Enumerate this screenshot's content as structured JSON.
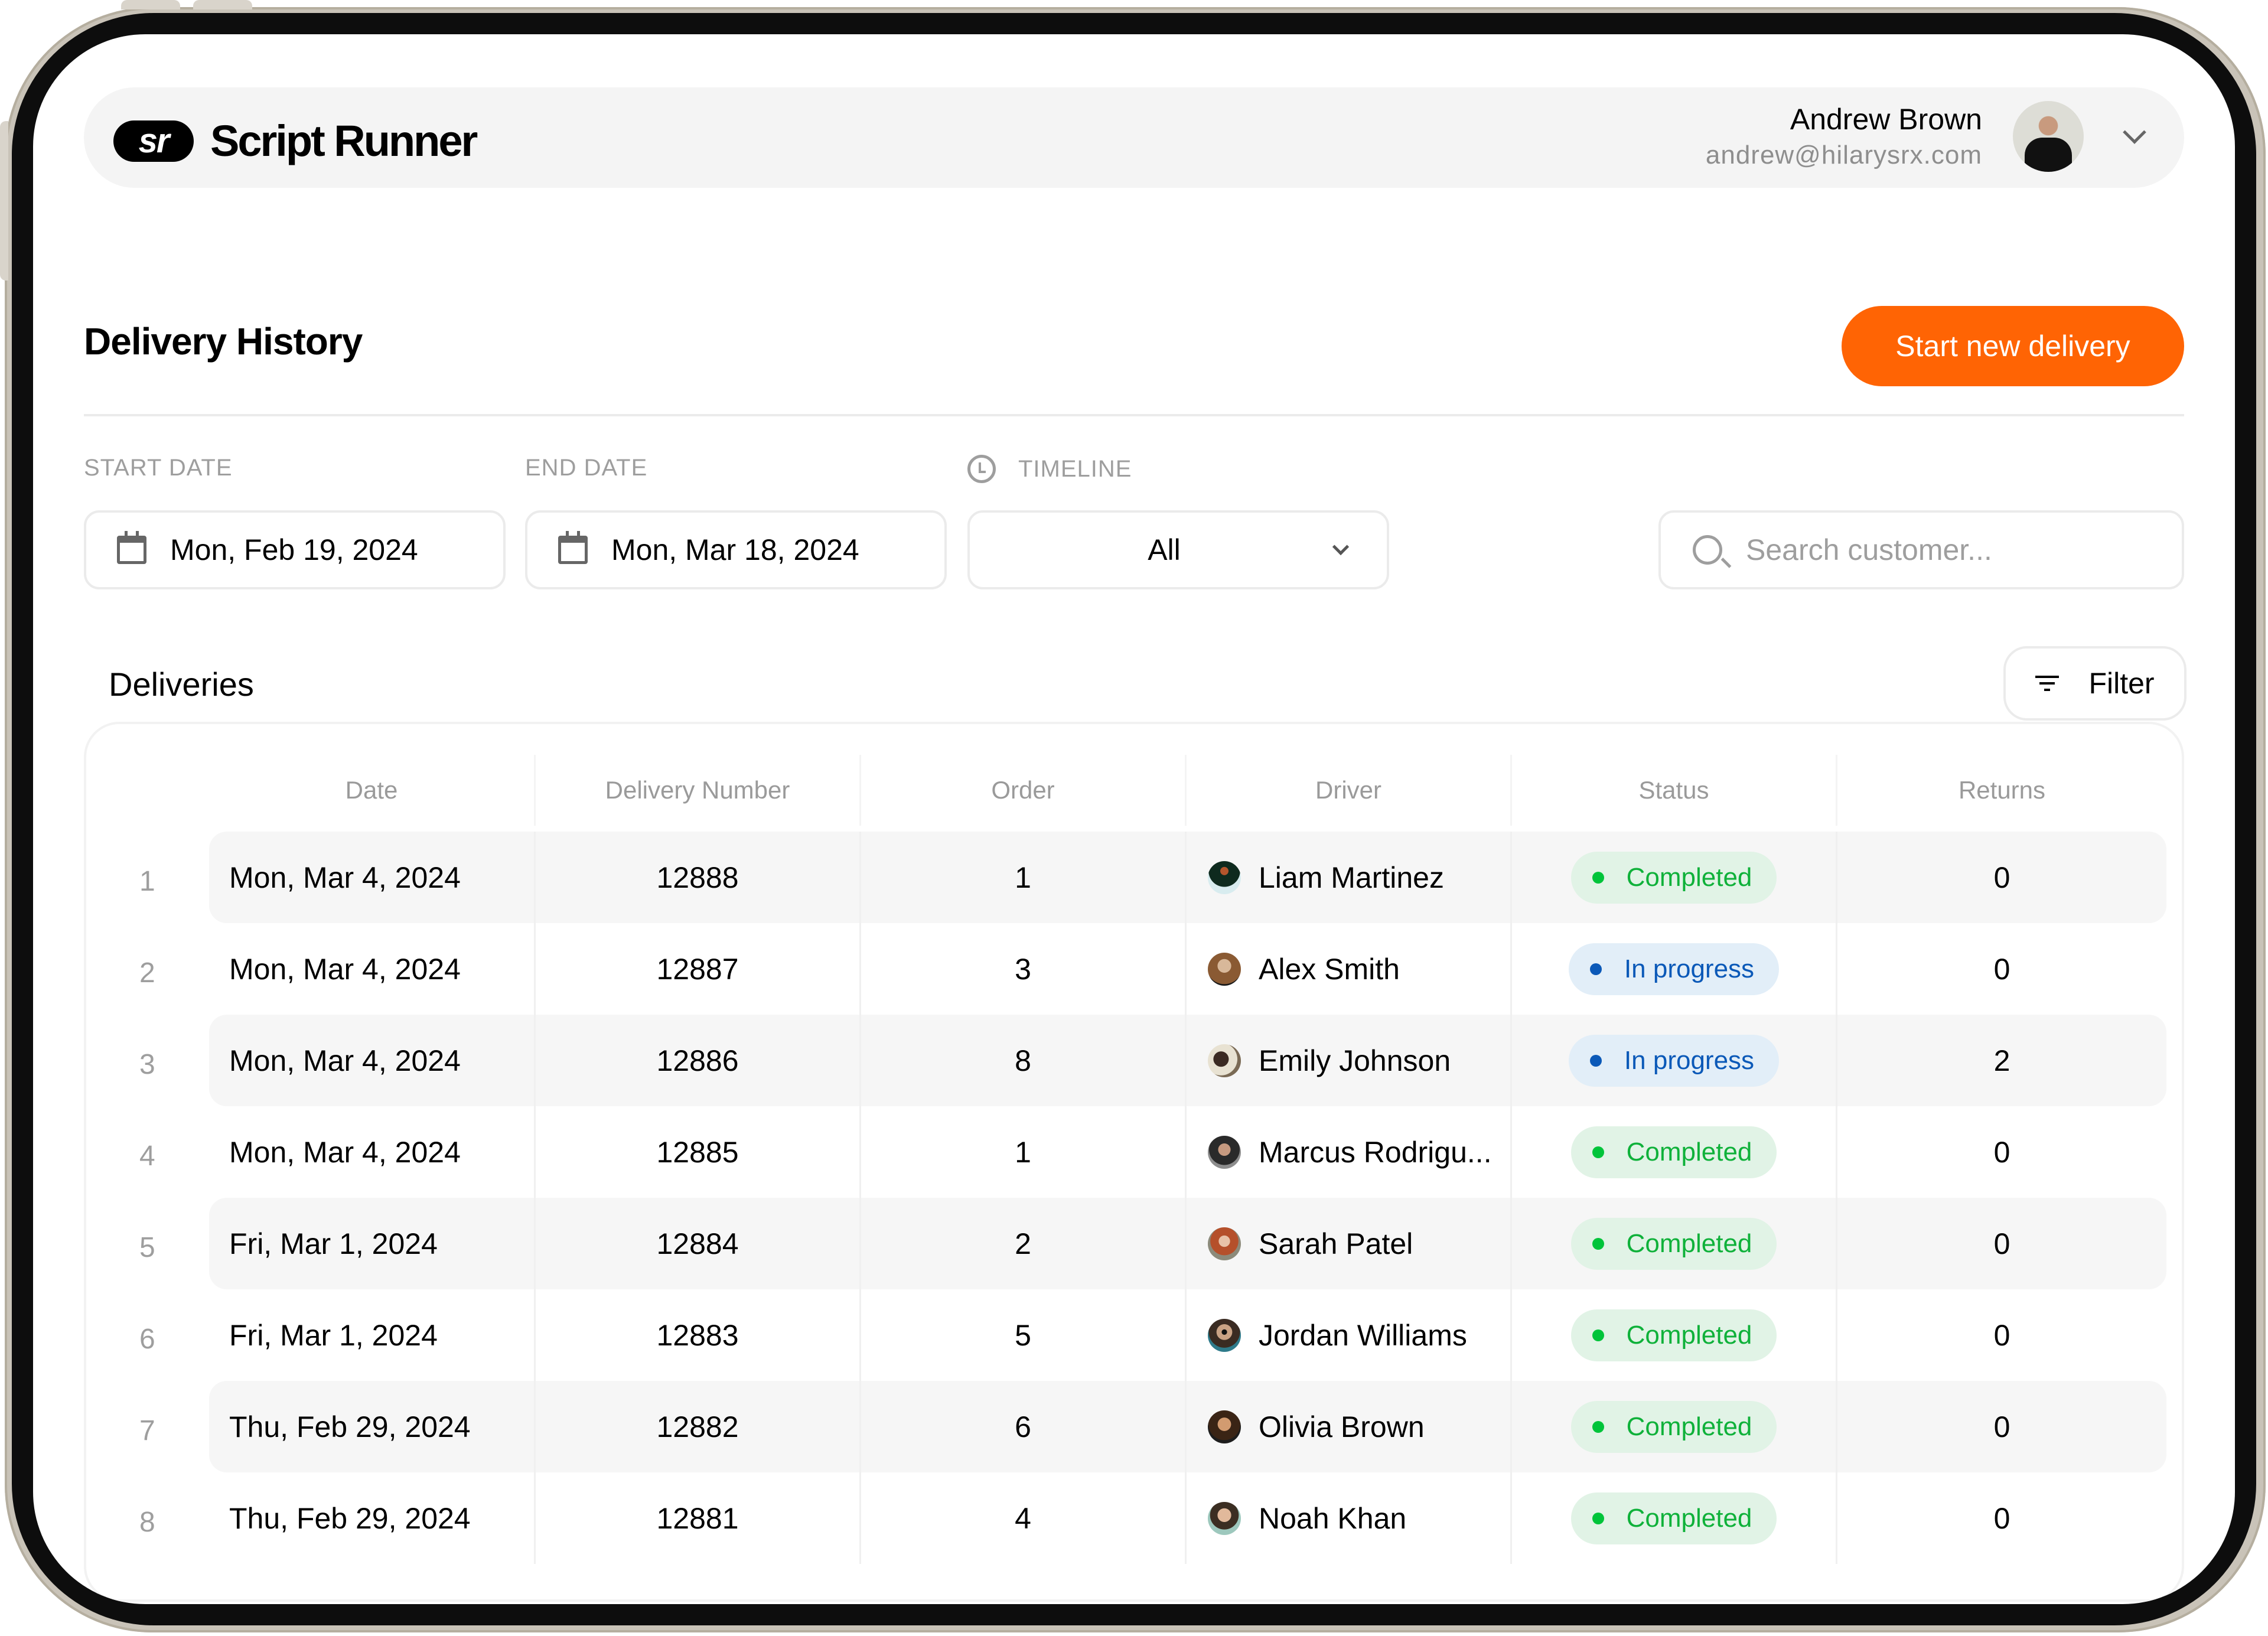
{
  "app": {
    "logo_mark": "sr",
    "name": "Script Runner"
  },
  "user": {
    "name": "Andrew Brown",
    "email": "andrew@hilarysrx.com",
    "avatar_icon": "user-avatar-photo",
    "menu_icon": "chevron-down-icon"
  },
  "page": {
    "title": "Delivery History",
    "primary_action": "Start new delivery"
  },
  "filters": {
    "start_date": {
      "label": "START DATE",
      "value": "Mon, Feb 19, 2024",
      "icon": "calendar-icon"
    },
    "end_date": {
      "label": "END DATE",
      "value": "Mon, Mar 18, 2024",
      "icon": "calendar-icon"
    },
    "timeline": {
      "label": "TIMELINE",
      "value": "All",
      "icon": "clock-icon"
    },
    "search": {
      "placeholder": "Search customer...",
      "value": "",
      "icon": "search-icon"
    }
  },
  "deliveries": {
    "title": "Deliveries",
    "filter_label": "Filter",
    "columns": [
      "Date",
      "Delivery Number",
      "Order",
      "Driver",
      "Status",
      "Returns"
    ],
    "rows": [
      {
        "index": "1",
        "date": "Mon, Mar 4, 2024",
        "number": "12888",
        "order": "1",
        "driver": "Liam Martinez",
        "status": "Completed",
        "returns": "0"
      },
      {
        "index": "2",
        "date": "Mon, Mar 4, 2024",
        "number": "12887",
        "order": "3",
        "driver": "Alex Smith",
        "status": "In progress",
        "returns": "0"
      },
      {
        "index": "3",
        "date": "Mon, Mar 4, 2024",
        "number": "12886",
        "order": "8",
        "driver": "Emily Johnson",
        "status": "In progress",
        "returns": "2"
      },
      {
        "index": "4",
        "date": "Mon, Mar 4, 2024",
        "number": "12885",
        "order": "1",
        "driver": "Marcus Rodrigu...",
        "status": "Completed",
        "returns": "0"
      },
      {
        "index": "5",
        "date": "Fri, Mar 1, 2024",
        "number": "12884",
        "order": "2",
        "driver": "Sarah Patel",
        "status": "Completed",
        "returns": "0"
      },
      {
        "index": "6",
        "date": "Fri, Mar 1, 2024",
        "number": "12883",
        "order": "5",
        "driver": "Jordan Williams",
        "status": "Completed",
        "returns": "0"
      },
      {
        "index": "7",
        "date": "Thu, Feb 29, 2024",
        "number": "12882",
        "order": "6",
        "driver": "Olivia Brown",
        "status": "Completed",
        "returns": "0"
      },
      {
        "index": "8",
        "date": "Thu, Feb 29, 2024",
        "number": "12881",
        "order": "4",
        "driver": "Noah Khan",
        "status": "Completed",
        "returns": "0"
      }
    ]
  },
  "colors": {
    "accent": "#ff6404",
    "completed_text": "#0fb13a",
    "completed_bg": "#e1f3e6",
    "in_progress_text": "#0b59b8",
    "in_progress_bg": "#e2eef8"
  }
}
